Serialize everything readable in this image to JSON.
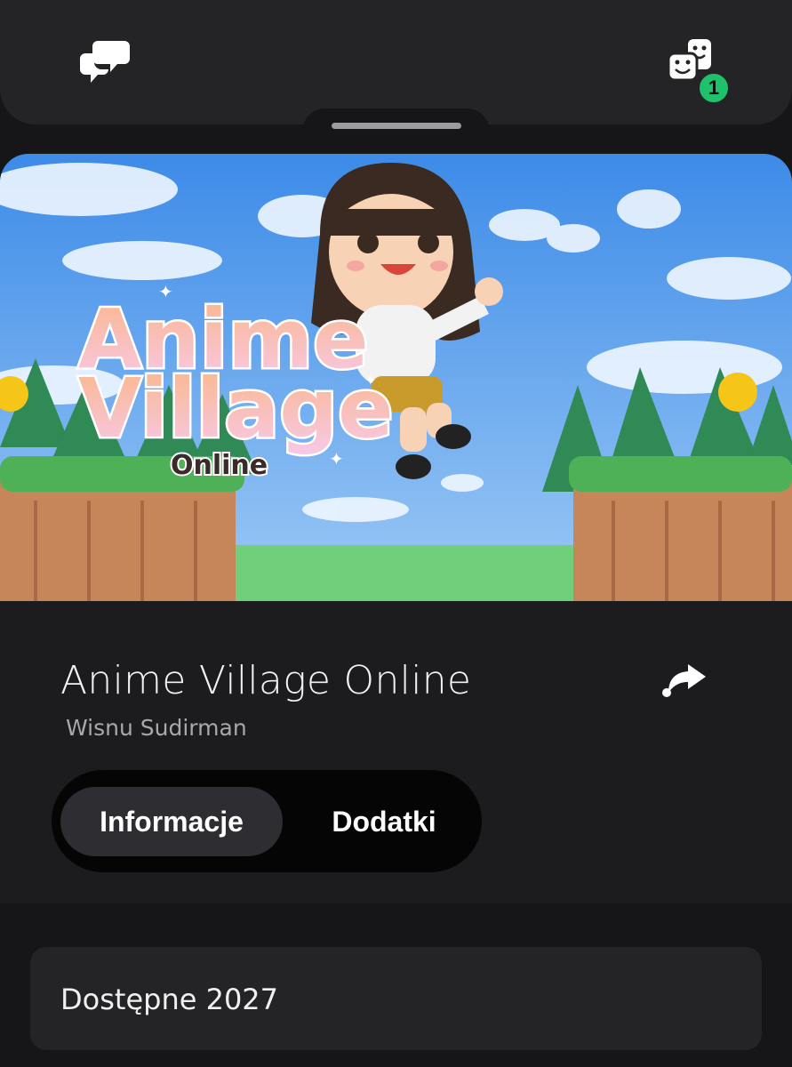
{
  "header": {
    "chat_icon": "chat-bubbles-icon",
    "party_icon": "party-faces-icon",
    "party_badge_count": "1",
    "badge_color": "#1ec26a"
  },
  "hero": {
    "logo_line1": "Anime",
    "logo_line2": "Village",
    "logo_line3": "Online"
  },
  "game": {
    "title": "Anime Village Online",
    "publisher": "Wisnu Sudirman",
    "share_icon": "share-arrow-icon"
  },
  "tabs": [
    {
      "label": "Informacje",
      "active": true
    },
    {
      "label": "Dodatki",
      "active": false
    }
  ],
  "availability": {
    "text": "Dostępne 2027"
  },
  "colors": {
    "background": "#161618",
    "topbar": "#242426",
    "active_tab": "#2e2e32"
  }
}
